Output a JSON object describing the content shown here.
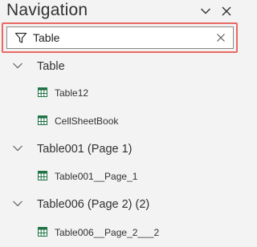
{
  "pane": {
    "title": "Navigation",
    "search": {
      "value": "Table",
      "placeholder": ""
    }
  },
  "tree": {
    "groups": [
      {
        "label": "Table",
        "children": [
          "Table12",
          "CellSheetBook"
        ]
      },
      {
        "label": "Table001 (Page 1)",
        "children": [
          "Table001__Page_1"
        ]
      },
      {
        "label": "Table006 (Page 2) (2)",
        "children": [
          "Table006__Page_2___2"
        ]
      }
    ]
  },
  "colors": {
    "highlight_outline": "#e86a62",
    "table_icon": "#217346",
    "text": "#323130",
    "background": "#f3f3f3"
  },
  "icons": {
    "filter": "filter-icon",
    "clear": "clear-icon",
    "expand": "chevron-down-icon",
    "table": "table-icon",
    "collapse_pane": "chevron-down-icon",
    "close_pane": "close-icon"
  }
}
